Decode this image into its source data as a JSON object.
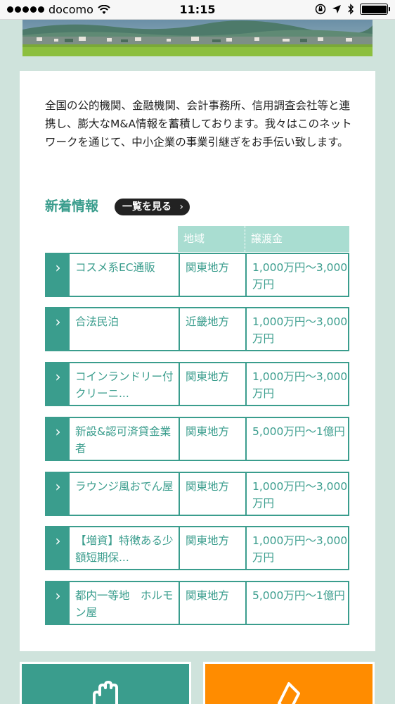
{
  "status_bar": {
    "carrier": "docomo",
    "time": "11:15"
  },
  "intro": {
    "text": "全国の公的機関、金融機関、会計事務所、信用調査会社等と連携し、膨大なM&A情報を蓄積しております。我々はこのネットワークを通じて、中小企業の事業引継ぎをお手伝い致します。"
  },
  "news": {
    "title": "新着情報",
    "view_all": "一覧を見る",
    "headers": {
      "region": "地域",
      "price": "譲渡金"
    },
    "rows": [
      {
        "name": "コスメ系EC通販",
        "region": "関東地方",
        "price": "1,000万円〜3,000万円"
      },
      {
        "name": "合法民泊",
        "region": "近畿地方",
        "price": "1,000万円〜3,000万円"
      },
      {
        "name": "コインランドリー付クリーニ...",
        "region": "関東地方",
        "price": "1,000万円〜3,000万円"
      },
      {
        "name": "新設&認可済貸金業者",
        "region": "関東地方",
        "price": "5,000万円〜1億円"
      },
      {
        "name": "ラウンジ風おでん屋",
        "region": "関東地方",
        "price": "1,000万円〜3,000万円"
      },
      {
        "name": "【増資】特徴ある少額短期保...",
        "region": "関東地方",
        "price": "1,000万円〜3,000万円"
      },
      {
        "name": "都内一等地　ホルモン屋",
        "region": "関東地方",
        "price": "5,000万円〜1億円"
      }
    ]
  },
  "colors": {
    "accent": "#3a9d8d",
    "header_bg": "#a9ddd1",
    "page_bg": "#cfe3dc",
    "orange": "#ff8c00"
  },
  "icons": {
    "status": [
      "signal-dots-icon",
      "wifi-icon",
      "orientation-lock-icon",
      "location-arrow-icon",
      "bluetooth-icon",
      "battery-icon"
    ],
    "row_arrow": "chevron-right-icon",
    "green_button": "hand-icon",
    "orange_button": "document-icon"
  }
}
